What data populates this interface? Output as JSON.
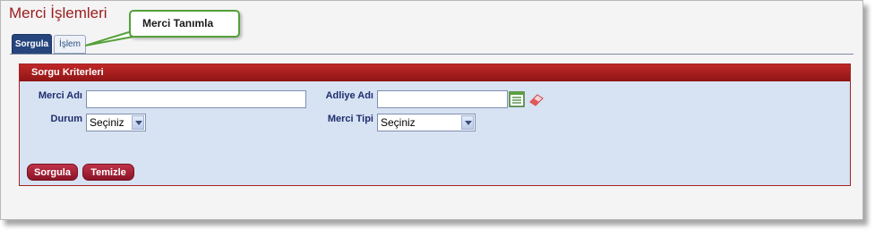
{
  "page": {
    "title": "Merci İşlemleri"
  },
  "tabs": [
    {
      "label": "Sorgula",
      "active": true
    },
    {
      "label": "İşlem",
      "active": false
    }
  ],
  "callout": {
    "text": "Merci Tanımla"
  },
  "panel": {
    "header": "Sorgu Kriterleri",
    "fields": {
      "merci_adi": {
        "label": "Merci Adı",
        "value": ""
      },
      "adliye_adi": {
        "label": "Adliye Adı",
        "value": ""
      },
      "durum": {
        "label": "Durum",
        "selected": "Seçiniz"
      },
      "merci_tipi": {
        "label": "Merci Tipi",
        "selected": "Seçiniz"
      }
    },
    "icons": {
      "list": "list-icon",
      "clear": "eraser-icon"
    },
    "buttons": {
      "search": "Sorgula",
      "clear": "Temizle"
    }
  },
  "colors": {
    "title": "#9b1b1b",
    "panel_header": "#b01f1f",
    "panel_bg": "#d7e2f3",
    "tab_active": "#26457d",
    "callout_border": "#55a03a",
    "button": "#a8203a"
  }
}
